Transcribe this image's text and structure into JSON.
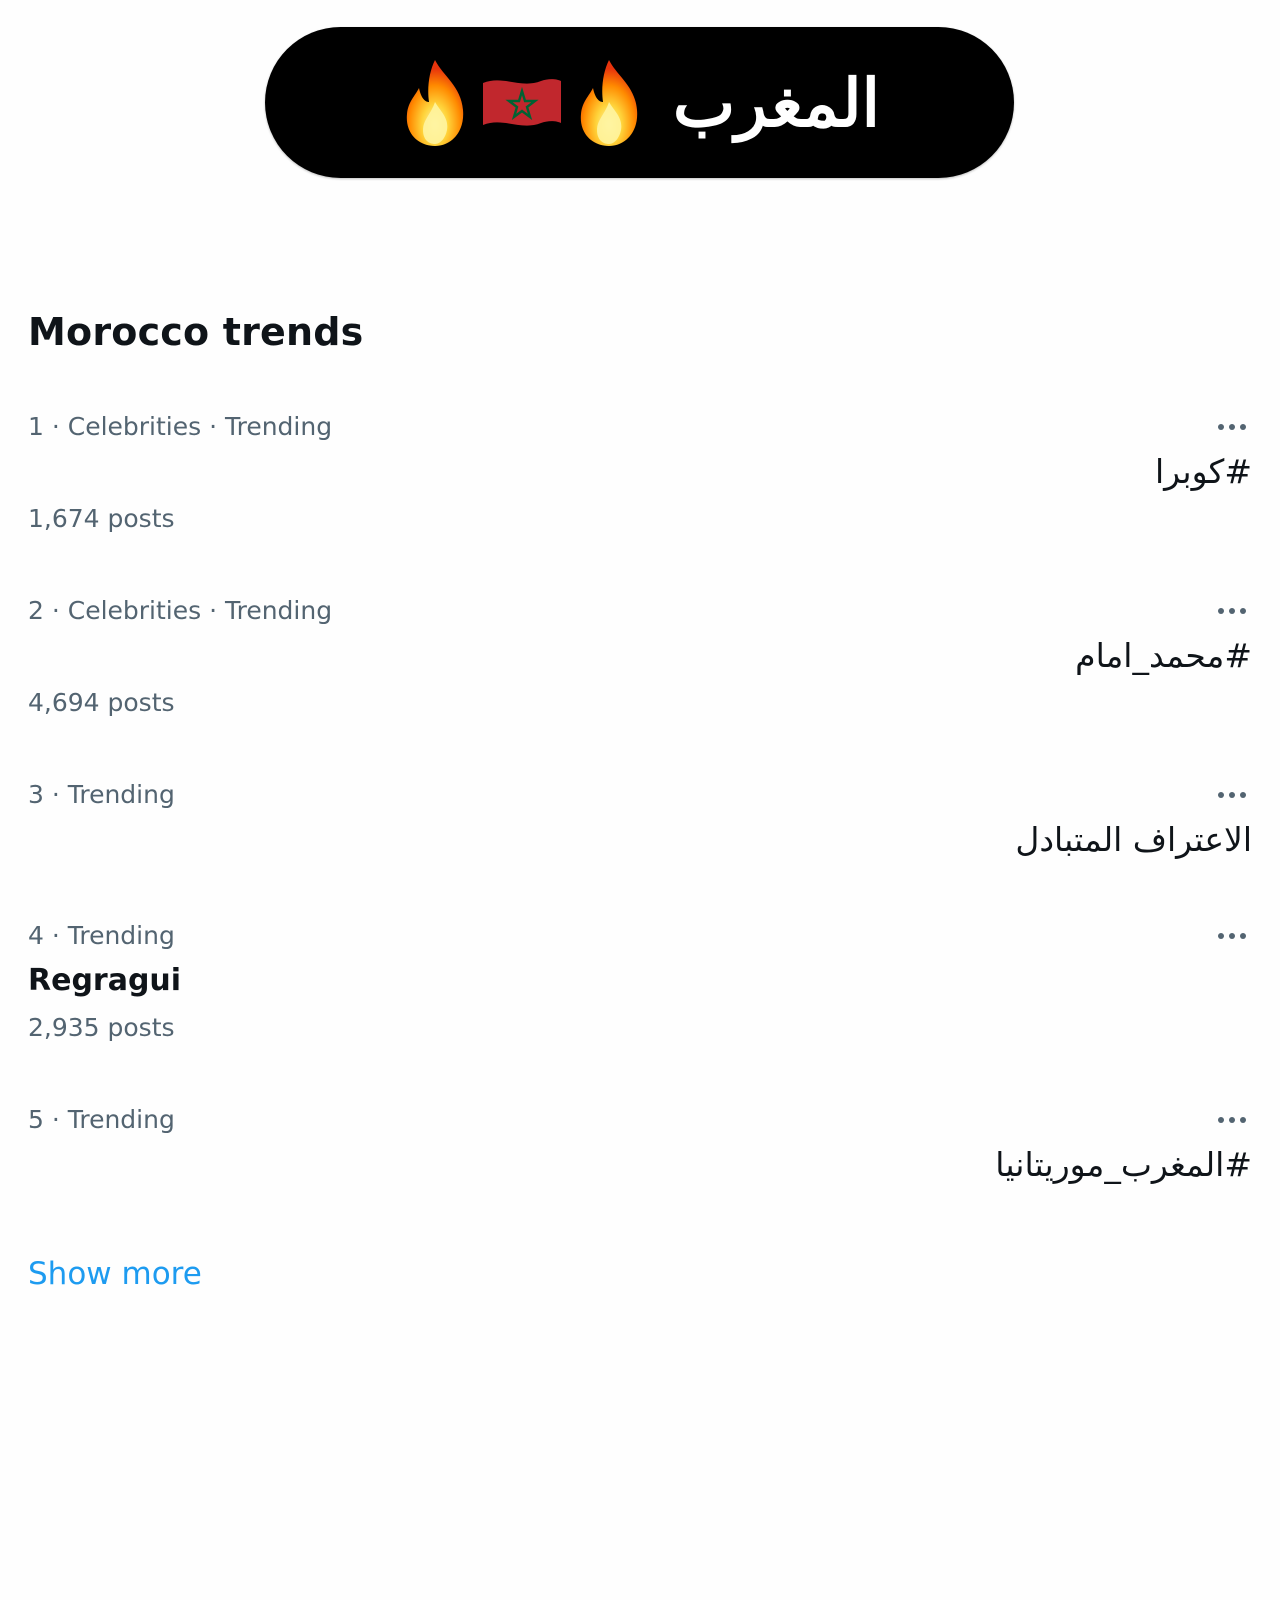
{
  "banner": {
    "title": "المغرب",
    "icons": [
      "fire-icon",
      "morocco-flag-icon",
      "fire-icon"
    ]
  },
  "trends_panel": {
    "title": "Morocco trends",
    "items": [
      {
        "rank_meta": "1 · Celebrities · Trending",
        "name": "#كوبرا",
        "posts": "1,674 posts"
      },
      {
        "rank_meta": "2 · Celebrities · Trending",
        "name": "#محمد_امام",
        "posts": "4,694 posts"
      },
      {
        "rank_meta": "3 · Trending",
        "name": "الاعتراف المتبادل"
      },
      {
        "rank_meta": "4 · Trending",
        "name": "Regragui",
        "posts": "2,935 posts"
      },
      {
        "rank_meta": "5 · Trending",
        "name": "#المغرب_موريتانيا"
      }
    ],
    "show_more": "Show more"
  },
  "colors": {
    "text_primary": "#0f1419",
    "text_secondary": "#536471",
    "link": "#1d9bf0",
    "banner_bg": "#000000",
    "flag_red": "#c1272d",
    "flag_green": "#006233"
  }
}
